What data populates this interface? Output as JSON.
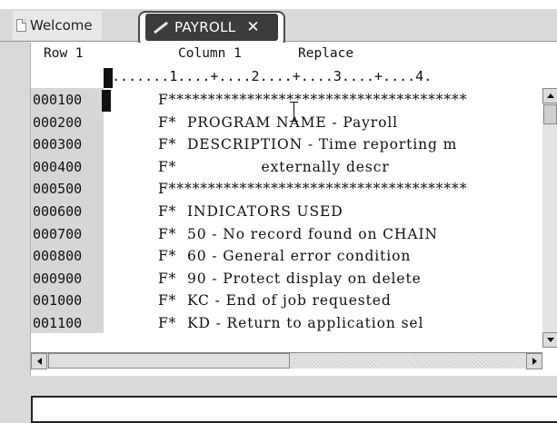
{
  "tabs": [
    {
      "label": "Welcome",
      "icon": "document-icon"
    },
    {
      "label": "PAYROLL",
      "icon": "pencil-icon",
      "close": "✕",
      "active": true
    }
  ],
  "status": {
    "row": "Row 1",
    "column": "Column 1",
    "mode": "Replace"
  },
  "ruler": "........1....+....2....+....3....+....4.",
  "lines": [
    {
      "num": "000100",
      "code": "F**************************************"
    },
    {
      "num": "000200",
      "code": "F*  PROGRAM NAME - Payroll"
    },
    {
      "num": "000300",
      "code": "F*  DESCRIPTION - Time reporting m"
    },
    {
      "num": "000400",
      "code": "F*                externally descr"
    },
    {
      "num": "000500",
      "code": "F**************************************"
    },
    {
      "num": "000600",
      "code": "F*  INDICATORS USED"
    },
    {
      "num": "000700",
      "code": "F*  50 - No record found on CHAIN"
    },
    {
      "num": "000800",
      "code": "F*  60 - General error condition"
    },
    {
      "num": "000900",
      "code": "F*  90 - Protect display on delete"
    },
    {
      "num": "001000",
      "code": "F*  KC - End of job requested"
    },
    {
      "num": "001100",
      "code": "F*  KD - Return to application sel"
    }
  ],
  "command_line": {
    "value": ""
  }
}
